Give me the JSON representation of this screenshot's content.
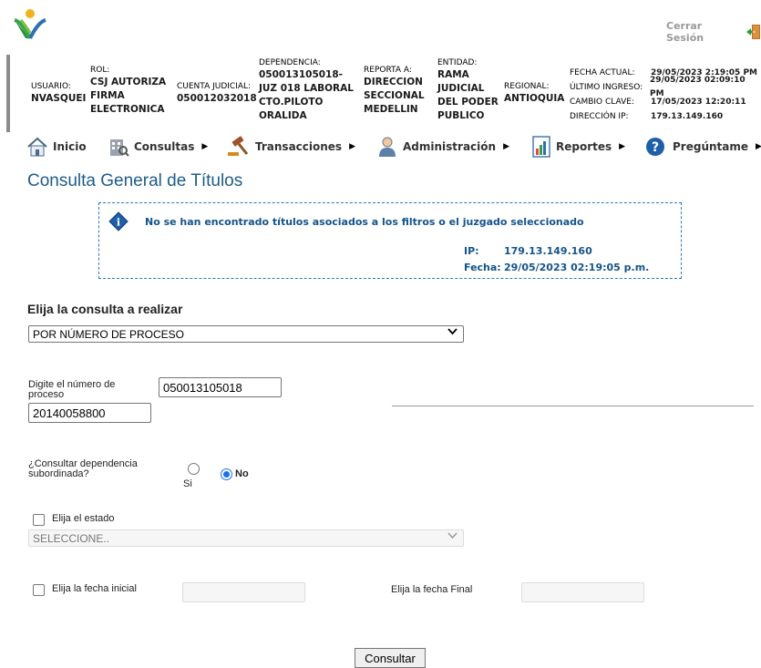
{
  "header": {
    "logout_label": "Cerrar Sesión",
    "fields": {
      "usuario_label": "USUARIO:",
      "usuario_value": "NVASQUEI",
      "rol_label": "ROL:",
      "rol_value_lines": [
        "CSJ AUTORIZA",
        "FIRMA",
        "ELECTRONICA"
      ],
      "cuenta_label": "CUENTA JUDICIAL:",
      "cuenta_value": "050012032018",
      "dependencia_label": "DEPENDENCIA:",
      "dependencia_value_lines": [
        "050013105018-",
        "JUZ 018 LABORAL",
        "CTO.PILOTO",
        "ORALIDA"
      ],
      "reporta_label": "REPORTA A:",
      "reporta_value_lines": [
        "DIRECCION",
        "SECCIONAL",
        "MEDELLIN"
      ],
      "entidad_label": "ENTIDAD:",
      "entidad_value_lines": [
        "RAMA",
        "JUDICIAL",
        "DEL PODER",
        "PUBLICO"
      ],
      "regional_label": "REGIONAL:",
      "regional_value": "ANTIOQUIA",
      "fecha_actual_label": "FECHA ACTUAL:",
      "fecha_actual_value": "29/05/2023 2:19:05 PM",
      "ultimo_ingreso_label": "ÚLTIMO INGRESO:",
      "ultimo_ingreso_value": "29/05/2023 02:09:10 PM",
      "cambio_clave_label": "CAMBIO CLAVE:",
      "cambio_clave_value": "17/05/2023 12:20:11",
      "direccion_ip_label": "DIRECCIÓN IP:",
      "direccion_ip_value": "179.13.149.160"
    }
  },
  "menu": {
    "items": [
      {
        "label": "Inicio",
        "icon": "home-icon",
        "has_arrow": false
      },
      {
        "label": "Consultas",
        "icon": "building-icon",
        "has_arrow": true
      },
      {
        "label": "Transacciones",
        "icon": "gavel-icon",
        "has_arrow": true
      },
      {
        "label": "Administración",
        "icon": "user-icon",
        "has_arrow": true
      },
      {
        "label": "Reportes",
        "icon": "report-icon",
        "has_arrow": true
      },
      {
        "label": "Pregúntame",
        "icon": "help-icon",
        "has_arrow": true
      }
    ]
  },
  "page": {
    "title": "Consulta General de Títulos",
    "notice": {
      "message": "No se han encontrado títulos asociados a los filtros o el juzgado seleccionado",
      "ip_label": "IP:",
      "ip_value": "179.13.149.160",
      "fecha_label": "Fecha:",
      "fecha_value": "29/05/2023 02:19:05 p.m."
    }
  },
  "form": {
    "query_type_label": "Elija la consulta a realizar",
    "query_type_value": "POR NÚMERO DE PROCESO",
    "process_number_label": "Digite el número de proceso",
    "process_prefix_value": "050013105018",
    "process_suffix_value": "20140058800",
    "subordinate_label": "¿Consultar dependencia subordinada?",
    "option_si": "Si",
    "option_no": "No",
    "subordinate_selected": "No",
    "state_label": "Elija el estado",
    "state_value": "SELECCIONE..",
    "start_date_label": "Elija la fecha inicial",
    "end_date_label": "Elija la fecha Final",
    "submit_label": "Consultar"
  },
  "colors": {
    "title_blue": "#1d5c88",
    "notice_blue": "#14548a",
    "logout_gray": "#9a9a9a",
    "radio_blue": "#1a73e8"
  }
}
